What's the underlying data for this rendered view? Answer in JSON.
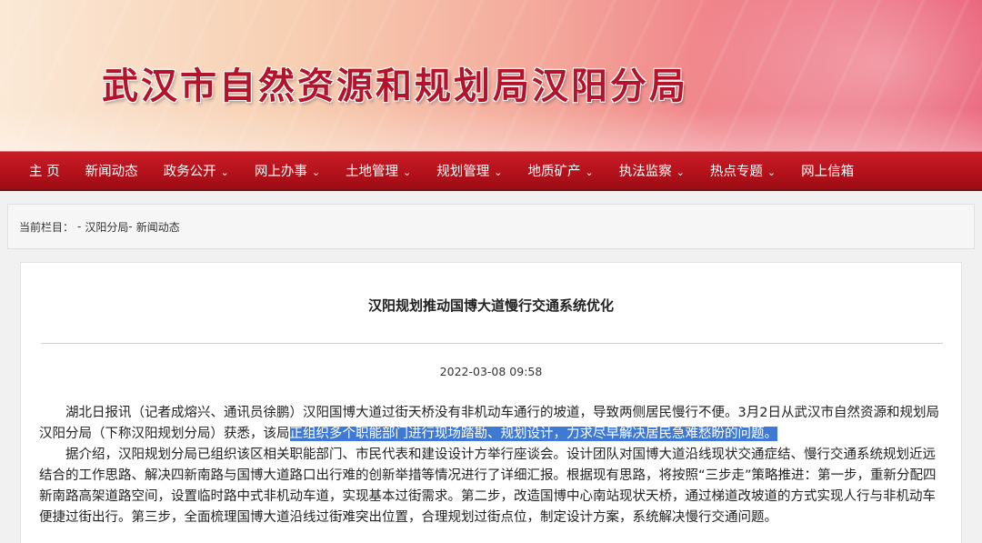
{
  "site": {
    "title": "武汉市自然资源和规划局汉阳分局"
  },
  "nav": [
    {
      "label": "主 页",
      "dropdown": false
    },
    {
      "label": "新闻动态",
      "dropdown": false
    },
    {
      "label": "政务公开",
      "dropdown": true
    },
    {
      "label": "网上办事",
      "dropdown": true
    },
    {
      "label": "土地管理",
      "dropdown": true
    },
    {
      "label": "规划管理",
      "dropdown": true
    },
    {
      "label": "地质矿产",
      "dropdown": true
    },
    {
      "label": "执法监察",
      "dropdown": true
    },
    {
      "label": "热点专题",
      "dropdown": true
    },
    {
      "label": "网上信箱",
      "dropdown": false
    }
  ],
  "breadcrumb": {
    "prefix": "当前栏目：",
    "sep": "-",
    "items": [
      "汉阳分局",
      "新闻动态"
    ]
  },
  "article": {
    "title": "汉阳规划推动国博大道慢行交通系统优化",
    "date": "2022-03-08 09:58",
    "p1_before": "湖北日报讯（记者成熔兴、通讯员徐鹏）汉阳国博大道过街天桥没有非机动车通行的坡道，导致两侧居民慢行不便。3月2日从武汉市自然资源和规划局汉阳分局（下称汉阳规划分局）获悉，该局",
    "p1_highlight": "正组织多个职能部门进行现场踏勘、规划设计，力求尽早解决居民急难愁盼的问题。",
    "p2": "据介绍，汉阳规划分局已组织该区相关职能部门、市民代表和建设设计方举行座谈会。设计团队对国博大道沿线现状交通症结、慢行交通系统规划近远结合的工作思路、解决四新南路与国博大道路口出行难的创新举措等情况进行了详细汇报。根据现有思路，将按照“三步走”策略推进：第一步，重新分配四新南路高架道路空间，设置临时路中式非机动车道，实现基本过街需求。第二步，改造国博中心南站现状天桥，通过梯道改坡道的方式实现人行与非机动车便捷过街出行。第三步，全面梳理国博大道沿线过街难突出位置，合理规划过街点位，制定设计方案，系统解决慢行交通问题。"
  },
  "colors": {
    "nav_bg": "#b4121b",
    "title_red": "#b3142c",
    "highlight": "#3f79d6"
  }
}
